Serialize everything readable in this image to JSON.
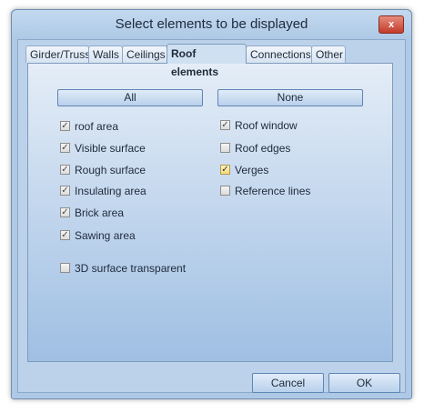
{
  "window": {
    "title": "Select elements to be displayed",
    "close_glyph": "x"
  },
  "tabs": [
    {
      "label": "Girder/Truss"
    },
    {
      "label": "Walls"
    },
    {
      "label": "Ceilings"
    },
    {
      "label": "Roof elements",
      "active": true
    },
    {
      "label": "Connections"
    },
    {
      "label": "Other"
    }
  ],
  "panel": {
    "all_label": "All",
    "none_label": "None",
    "left_items": [
      {
        "label": "roof area",
        "checked": true
      },
      {
        "label": "Visible surface",
        "checked": true
      },
      {
        "label": "Rough surface",
        "checked": true
      },
      {
        "label": "Insulating area",
        "checked": true
      },
      {
        "label": "Brick area",
        "checked": true
      },
      {
        "label": "Sawing area",
        "checked": true
      }
    ],
    "transparent": {
      "label": "3D surface transparent",
      "checked": false
    },
    "right_items": [
      {
        "label": "Roof window",
        "checked": true
      },
      {
        "label": "Roof edges",
        "checked": false
      },
      {
        "label": "Verges",
        "checked": true
      },
      {
        "label": "Reference lines",
        "checked": false
      }
    ]
  },
  "footer": {
    "cancel_label": "Cancel",
    "ok_label": "OK"
  },
  "colors": {
    "accent": "#aec9e6",
    "panel_top": "#e4edf7",
    "panel_bottom": "#9fbfe3"
  }
}
